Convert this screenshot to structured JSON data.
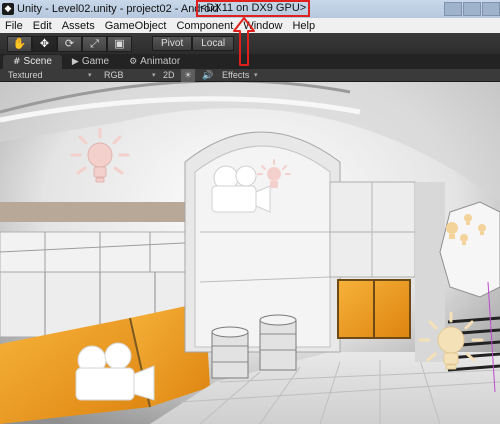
{
  "window": {
    "title": "Unity - Level02.unity - project02 - Android",
    "gpu_label": "<DX11 on DX9 GPU>",
    "app_icon": "unity-logo-icon",
    "app_icon_glyph": "◆"
  },
  "menu": {
    "items": [
      "File",
      "Edit",
      "Assets",
      "GameObject",
      "Component",
      "Window",
      "Help"
    ]
  },
  "toolbar": {
    "tools": [
      {
        "icon": "hand-icon",
        "glyph": "✋"
      },
      {
        "icon": "move-icon",
        "glyph": "✥"
      },
      {
        "icon": "rotate-icon",
        "glyph": "⟳"
      },
      {
        "icon": "scale-icon",
        "glyph": "⤢"
      },
      {
        "icon": "rect-icon",
        "glyph": "▣"
      }
    ],
    "pivot_label": "Pivot",
    "local_label": "Local"
  },
  "tabs": {
    "scene": "Scene",
    "game": "Game",
    "animator": "Animator",
    "scene_icon": "#",
    "game_icon": "▶",
    "animator_icon": "⚙"
  },
  "scene_toolbar": {
    "draw_mode": "Textured",
    "render_mode": "RGB",
    "mode_2d": "2D",
    "lighting_icon": "☀",
    "audio_icon": "🔊",
    "effects": "Effects",
    "dropdown_arrow": "▾"
  },
  "colors": {
    "annotation": "#e0201c",
    "accent_orange": "#f0a020",
    "wall": "#e6e6e6"
  }
}
